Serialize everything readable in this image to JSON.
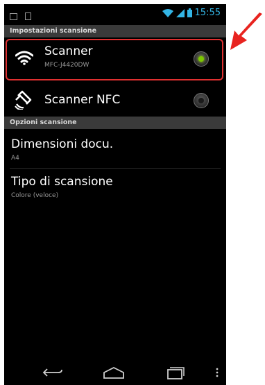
{
  "status_bar": {
    "time": "15:55",
    "colors": {
      "accent": "#33b5e5"
    }
  },
  "sections": {
    "scan_settings_header": "Impostazioni scansione",
    "scan_options_header": "Opzioni scansione"
  },
  "items": {
    "scanner": {
      "title": "Scanner",
      "subtitle": "MFC-J4420DW",
      "icon": "wifi-icon",
      "selected": true
    },
    "scanner_nfc": {
      "title": "Scanner NFC",
      "icon": "nfc-icon",
      "selected": false
    },
    "doc_size": {
      "title": "Dimensioni docu.",
      "value": "A4"
    },
    "scan_type": {
      "title": "Tipo di scansione",
      "value": "Colore (veloce)"
    }
  },
  "colors": {
    "radio_active": "#7cc800",
    "highlight_border": "#e03030",
    "pointer_arrow": "#e8231f"
  }
}
